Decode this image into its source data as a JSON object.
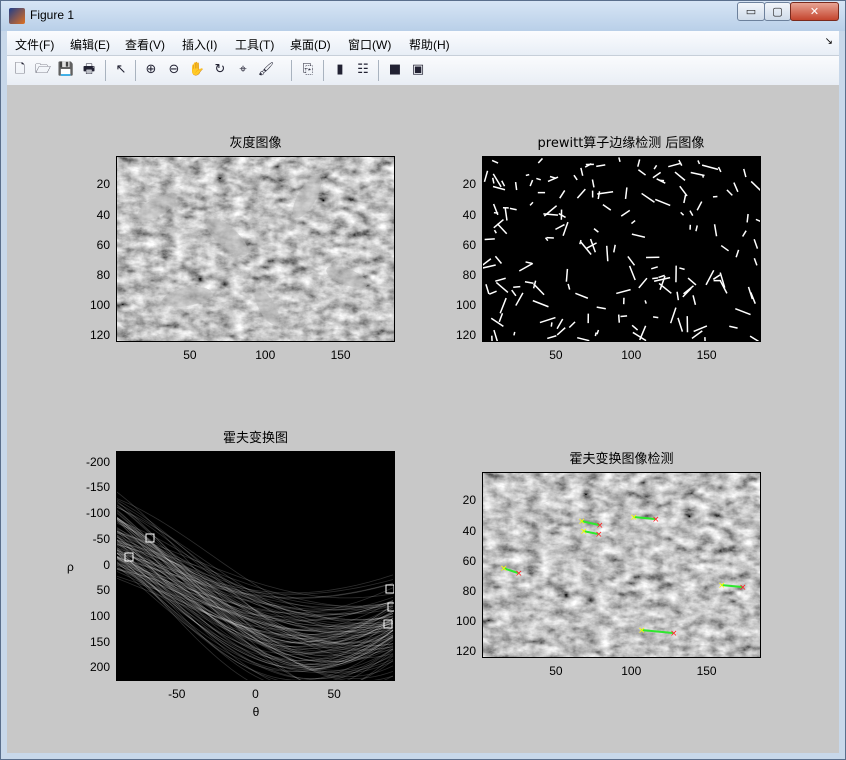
{
  "window": {
    "title": "Figure 1",
    "min_glyph": "▭",
    "max_glyph": "▢",
    "close_glyph": "✕"
  },
  "menu": {
    "items": [
      "文件(F)",
      "编辑(E)",
      "查看(V)",
      "插入(I)",
      "工具(T)",
      "桌面(D)",
      "窗口(W)",
      "帮助(H)"
    ],
    "dock_glyph": "↘"
  },
  "toolbar": {
    "icons": [
      "new-file-icon",
      "open-folder-icon",
      "save-icon",
      "print-icon",
      "pointer-icon",
      "zoom-in-icon",
      "zoom-out-icon",
      "pan-hand-icon",
      "rotate-3d-icon",
      "data-cursor-icon",
      "brush-icon",
      "link-plot-icon",
      "colorbar-icon",
      "legend-icon",
      "hide-plot-tools-icon",
      "show-plot-tools-icon"
    ],
    "glyphs": [
      "🗋",
      "🗁",
      "💾",
      "🖶",
      "↖",
      "⊕",
      "⊖",
      "✋",
      "↻",
      "⌖",
      "🖌",
      "⎘",
      "▮",
      "☷",
      "■",
      "▣"
    ]
  },
  "plots": {
    "gray": {
      "title": "灰度图像",
      "xticks": [
        "50",
        "100",
        "150"
      ],
      "yticks": [
        "20",
        "40",
        "60",
        "80",
        "100",
        "120"
      ]
    },
    "edge": {
      "title": "prewitt算子边缘检测 后图像",
      "xticks": [
        "50",
        "100",
        "150"
      ],
      "yticks": [
        "20",
        "40",
        "60",
        "80",
        "100",
        "120"
      ]
    },
    "hough": {
      "title": "霍夫变换图",
      "xticks": [
        "-50",
        "0",
        "50"
      ],
      "yticks": [
        "-200",
        "-150",
        "-100",
        "-50",
        "0",
        "50",
        "100",
        "150",
        "200"
      ],
      "xlabel": "θ",
      "ylabel": "ρ"
    },
    "detect": {
      "title": "霍夫变换图像检测",
      "xticks": [
        "50",
        "100",
        "150"
      ],
      "yticks": [
        "20",
        "40",
        "60",
        "80",
        "100",
        "120"
      ]
    }
  },
  "colors": {
    "line_green": "#2ee82e",
    "start_yellow": "#ffff00",
    "end_red": "#ff2020",
    "peak_box": "#ffffff"
  }
}
